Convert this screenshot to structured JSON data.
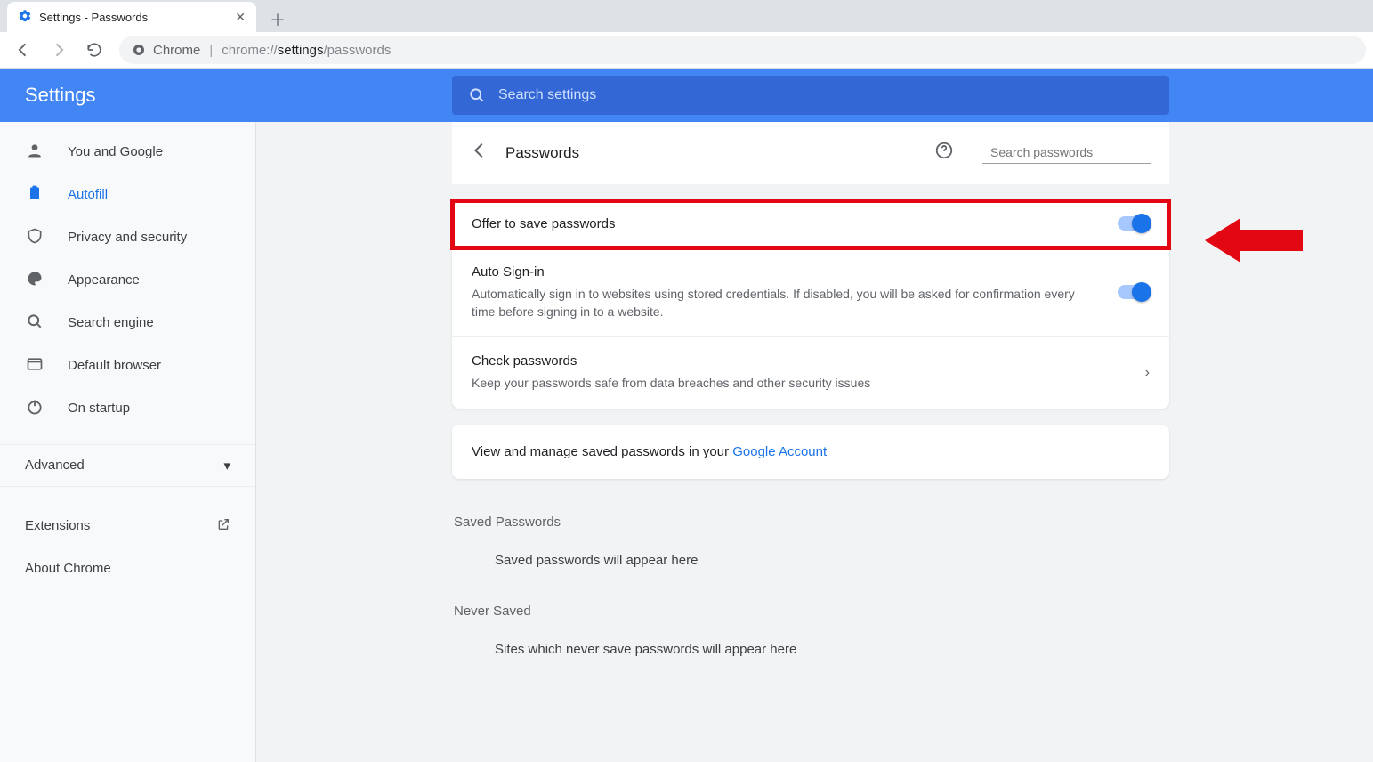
{
  "browser": {
    "tab_title": "Settings - Passwords",
    "omnibox_label": "Chrome",
    "url_dim1": "chrome://",
    "url_strong": "settings",
    "url_dim2": "/passwords"
  },
  "header": {
    "title": "Settings",
    "search_placeholder": "Search settings"
  },
  "sidebar": {
    "items": [
      {
        "label": "You and Google"
      },
      {
        "label": "Autofill"
      },
      {
        "label": "Privacy and security"
      },
      {
        "label": "Appearance"
      },
      {
        "label": "Search engine"
      },
      {
        "label": "Default browser"
      },
      {
        "label": "On startup"
      }
    ],
    "advanced": "Advanced",
    "extensions": "Extensions",
    "about": "About Chrome"
  },
  "panel": {
    "title": "Passwords",
    "search_placeholder": "Search passwords",
    "offer_label": "Offer to save passwords",
    "auto_label": "Auto Sign-in",
    "auto_sub": "Automatically sign in to websites using stored credentials. If disabled, you will be asked for confirmation every time before signing in to a website.",
    "check_label": "Check passwords",
    "check_sub": "Keep your passwords safe from data breaches and other security issues",
    "view_prefix": "View and manage saved passwords in your ",
    "view_link": "Google Account",
    "saved_h": "Saved Passwords",
    "saved_empty": "Saved passwords will appear here",
    "never_h": "Never Saved",
    "never_empty": "Sites which never save passwords will appear here"
  }
}
